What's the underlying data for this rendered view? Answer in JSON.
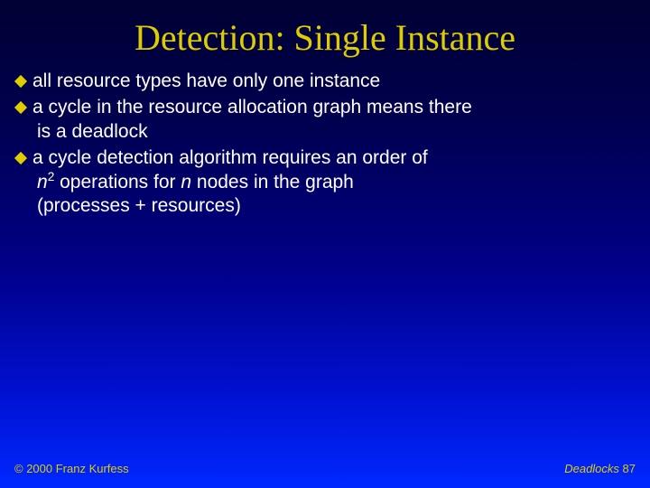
{
  "title": "Detection: Single Instance",
  "bullets": {
    "b1": "all resource types have only one instance",
    "b2_l1": "a cycle in the resource allocation graph means there",
    "b2_l2": "is a deadlock",
    "b3_l1": "a cycle detection algorithm requires an order of",
    "b3_l2a": "n",
    "b3_l2b": "2",
    "b3_l2c": " operations for ",
    "b3_l2d": "n",
    "b3_l2e": "  nodes in the graph",
    "b3_l3": "(processes + resources)"
  },
  "footer": {
    "left": "© 2000 Franz Kurfess",
    "right_label": "Deadlocks ",
    "right_num": "87"
  }
}
